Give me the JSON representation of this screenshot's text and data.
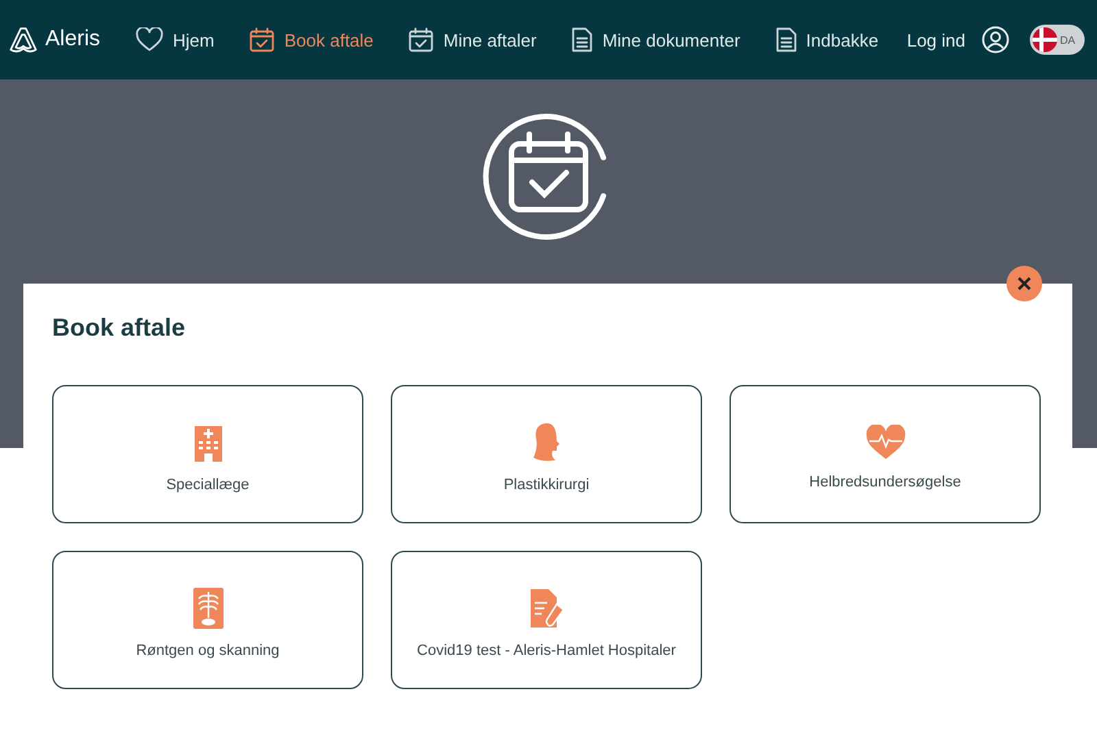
{
  "header": {
    "brand": "Aleris",
    "nav": [
      {
        "label": "Hjem",
        "selected": false
      },
      {
        "label": "Book aftale",
        "selected": true
      },
      {
        "label": "Mine aftaler",
        "selected": false
      },
      {
        "label": "Mine dokumenter",
        "selected": false
      },
      {
        "label": "Indbakke",
        "selected": false
      }
    ],
    "login": "Log ind",
    "language": "DA"
  },
  "modal": {
    "title": "Book aftale",
    "options": [
      {
        "label": "Speciallæge"
      },
      {
        "label": "Plastikkirurgi"
      },
      {
        "label": "Helbredsundersøgelse"
      },
      {
        "label": "Røntgen og skanning"
      },
      {
        "label": "Covid19 test - Aleris-Hamlet Hospitaler"
      }
    ]
  }
}
